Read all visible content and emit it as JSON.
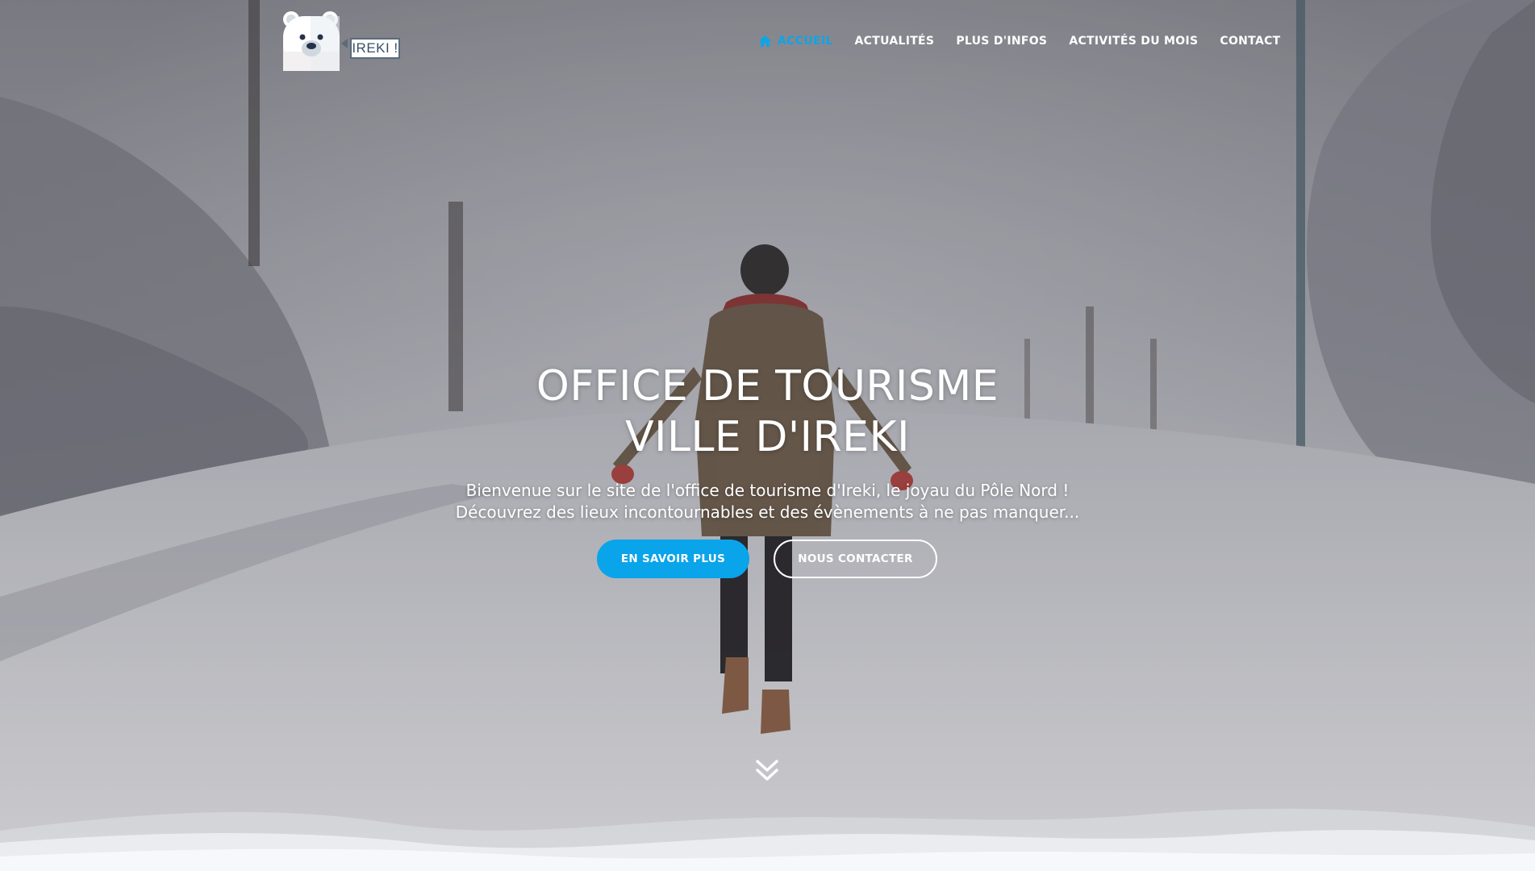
{
  "logo": {
    "text": "IREKI !"
  },
  "nav": {
    "items": [
      {
        "label": "ACCUEIL",
        "icon": "home-icon",
        "active": true
      },
      {
        "label": "ACTUALITÉS"
      },
      {
        "label": "PLUS D'INFOS"
      },
      {
        "label": "ACTIVITÉS DU MOIS"
      },
      {
        "label": "CONTACT"
      }
    ]
  },
  "hero": {
    "title_line1": "OFFICE DE TOURISME",
    "title_line2": "VILLE D'IREKI",
    "subtitle_line1": "Bienvenue sur le site de l'office de tourisme d'Ireki, le joyau du Pôle Nord !",
    "subtitle_line2": "Découvrez des lieux incontournables et des évènements à ne pas manquer...",
    "primary_button": "EN SAVOIR PLUS",
    "secondary_button": "NOUS CONTACTER",
    "scroll_icon": "double-chevron-down-icon"
  },
  "colors": {
    "accent": "#0aa4ea",
    "active_nav": "#0ea5e6",
    "text": "#ffffff"
  }
}
